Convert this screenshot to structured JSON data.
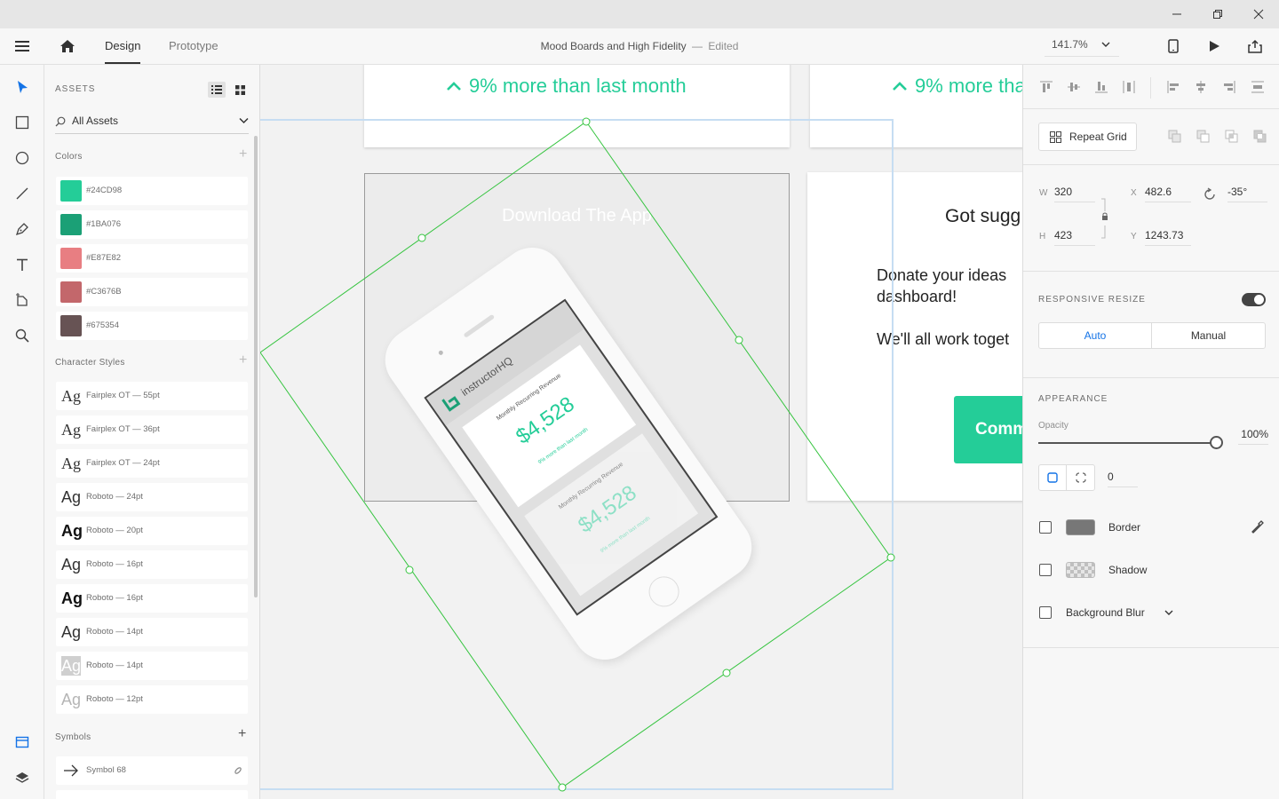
{
  "window": {
    "controls": [
      "minimize-icon",
      "restore-icon",
      "close-icon"
    ]
  },
  "topbar": {
    "menu_icon": "hamburger-icon",
    "home_icon": "home-icon",
    "tabs": [
      {
        "label": "Design",
        "active": true
      },
      {
        "label": "Prototype",
        "active": false
      }
    ],
    "document_title": "Mood Boards and High Fidelity",
    "separator": "—",
    "status": "Edited",
    "zoom": "141.7%",
    "device_icon": "phone-icon",
    "play_icon": "play-icon",
    "share_icon": "share-icon"
  },
  "toolbar": {
    "tools": [
      "select-icon",
      "rectangle-icon",
      "ellipse-icon",
      "line-icon",
      "pen-icon",
      "text-icon",
      "artboard-icon",
      "zoom-icon"
    ],
    "bottom": [
      "assets-icon",
      "layers-icon"
    ]
  },
  "assets": {
    "title": "ASSETS",
    "filter": "All Assets",
    "colors_label": "Colors",
    "colors": [
      {
        "hex": "#24CD98"
      },
      {
        "hex": "#1BA076"
      },
      {
        "hex": "#E87E82"
      },
      {
        "hex": "#C3676B"
      },
      {
        "hex": "#675354"
      }
    ],
    "character_styles_label": "Character Styles",
    "character_styles": [
      {
        "sample": "Ag",
        "label": "Fairplex OT — 55pt",
        "weight": "normal",
        "color": "#323232"
      },
      {
        "sample": "Ag",
        "label": "Fairplex OT — 36pt",
        "weight": "normal",
        "color": "#323232"
      },
      {
        "sample": "Ag",
        "label": "Fairplex OT — 24pt",
        "weight": "normal",
        "color": "#323232"
      },
      {
        "sample": "Ag",
        "label": "Roboto — 24pt",
        "weight": "normal",
        "color": "#323232"
      },
      {
        "sample": "Ag",
        "label": "Roboto — 20pt",
        "weight": "bold",
        "color": "#111111"
      },
      {
        "sample": "Ag",
        "label": "Roboto — 16pt",
        "weight": "normal",
        "color": "#323232"
      },
      {
        "sample": "Ag",
        "label": "Roboto — 16pt",
        "weight": "bold",
        "color": "#111111"
      },
      {
        "sample": "Ag",
        "label": "Roboto — 14pt",
        "weight": "normal",
        "color": "#323232"
      },
      {
        "sample": "Ag",
        "label": "Roboto — 14pt",
        "weight": "normal",
        "color": "#ffffff"
      },
      {
        "sample": "Ag",
        "label": "Roboto — 12pt",
        "weight": "normal",
        "color": "#b5b5b5"
      }
    ],
    "symbols_label": "Symbols",
    "symbols": [
      {
        "label": "Symbol 68"
      }
    ]
  },
  "canvas": {
    "card1_metric": "9% more than last month",
    "card2_metric": "9% more tha",
    "download_title": "Download The App",
    "phone_brand": "instructorHQ",
    "phone_card_title": "Monthly Recurring Revenue",
    "phone_card_value": "$4,528",
    "phone_card_metric": "9% more than last month",
    "suggest_title": "Got sugg",
    "suggest_body_1": "Donate your ideas",
    "suggest_body_2": "dashboard!",
    "suggest_body_3": "We'll all work toget",
    "suggest_button": "Comm"
  },
  "properties": {
    "repeat_grid": "Repeat Grid",
    "w_label": "W",
    "w": "320",
    "h_label": "H",
    "h": "423",
    "x_label": "X",
    "x": "482.6",
    "y_label": "Y",
    "y": "1243.73",
    "rotation": "-35°",
    "responsive_resize": "RESPONSIVE RESIZE",
    "auto": "Auto",
    "manual": "Manual",
    "appearance": "APPEARANCE",
    "opacity_label": "Opacity",
    "opacity": "100%",
    "opacity_value": 1.0,
    "radius": "0",
    "border": "Border",
    "shadow": "Shadow",
    "background_blur": "Background Blur",
    "accent": "#24CD98",
    "selection_color": "#2ecc40"
  }
}
